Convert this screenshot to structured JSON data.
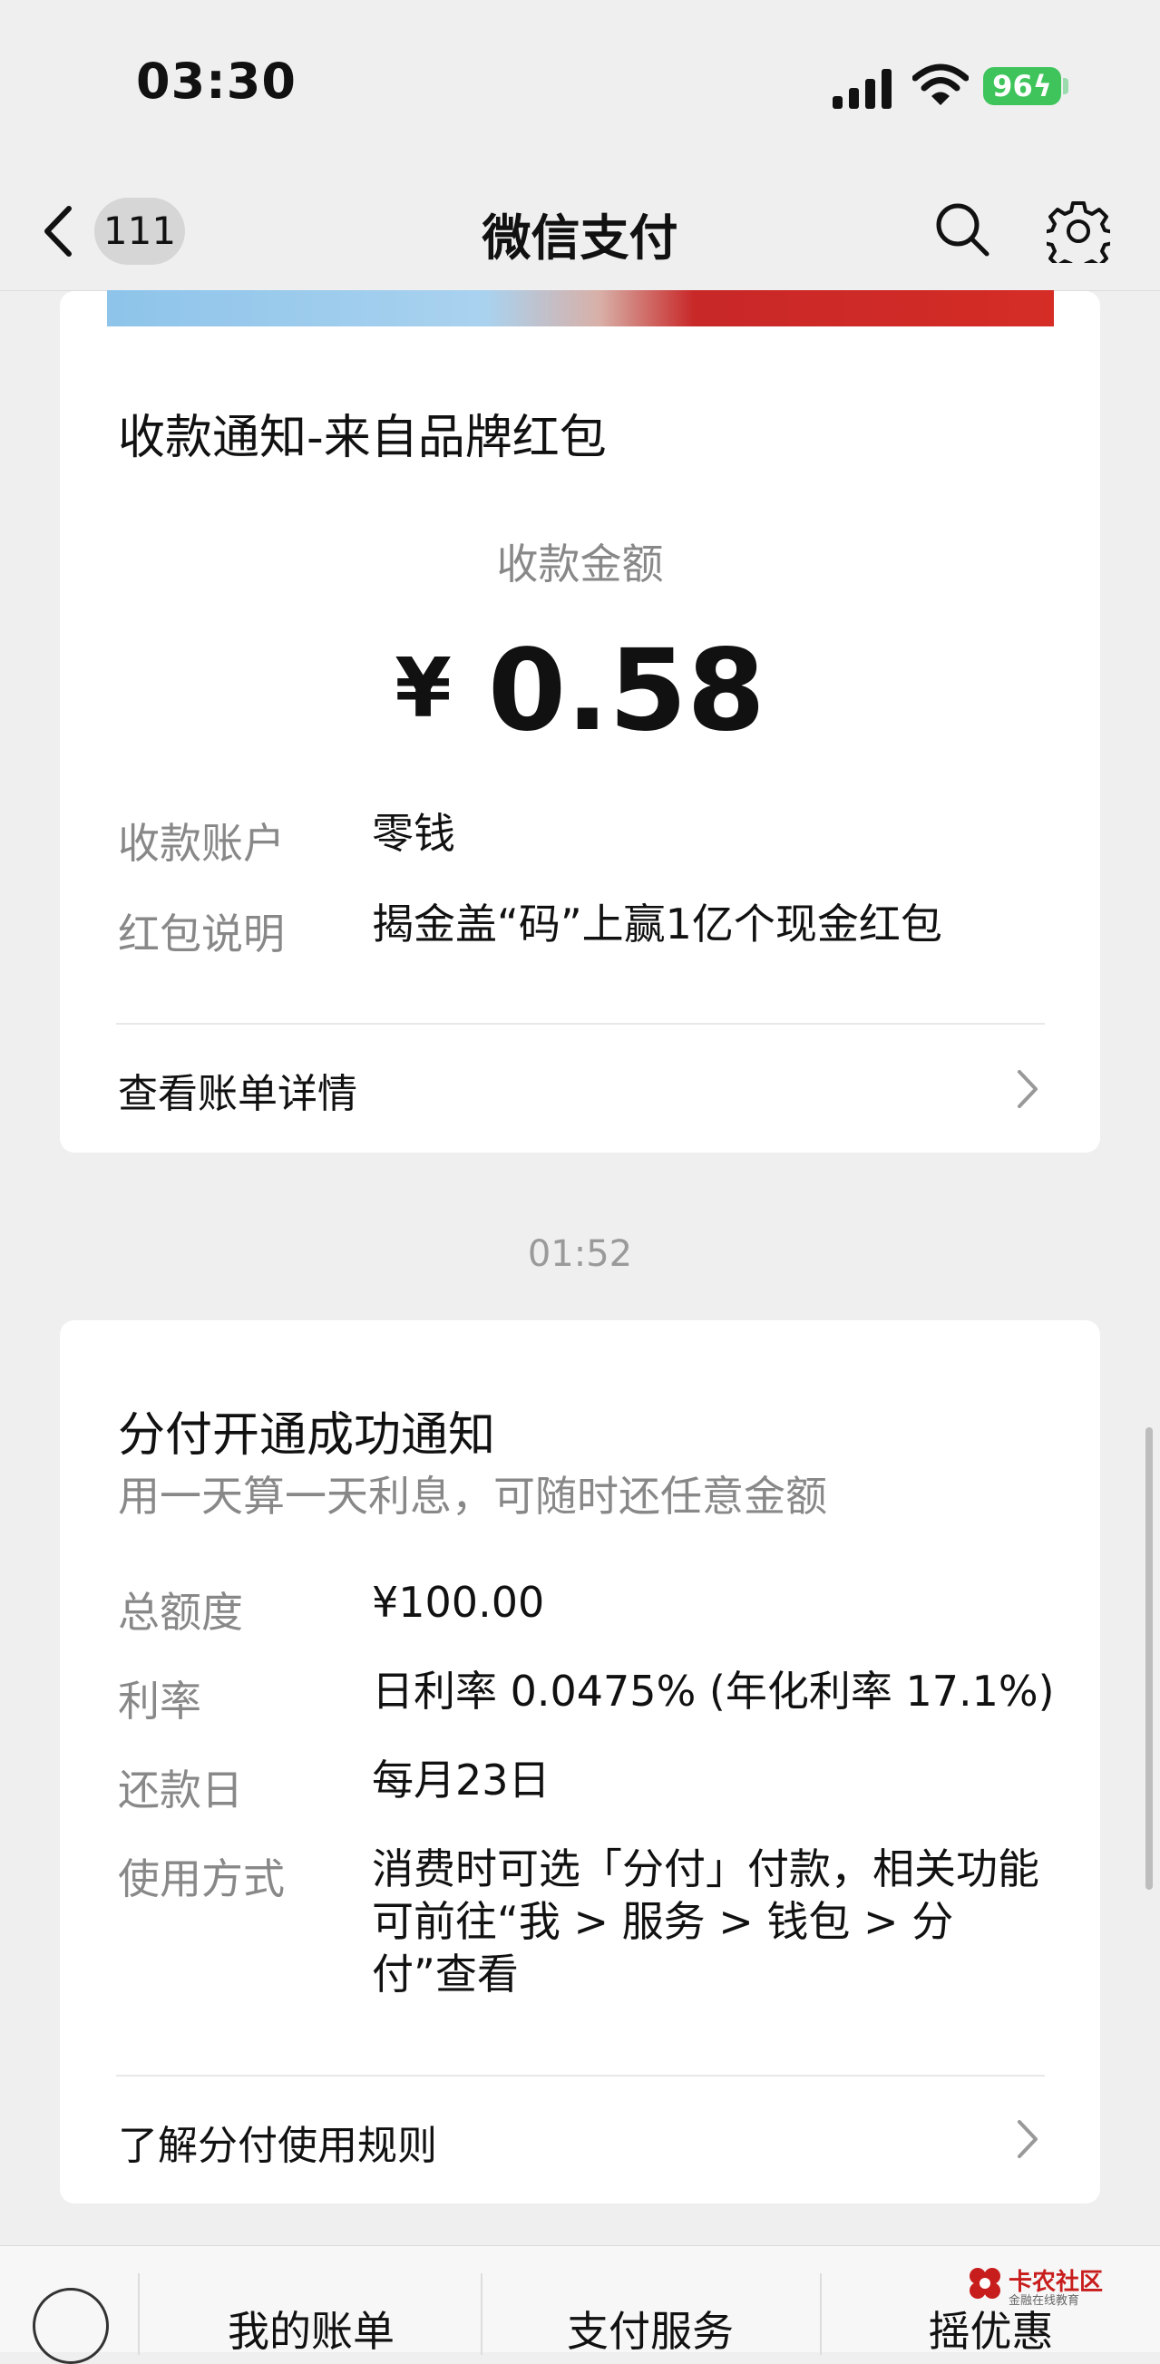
{
  "status_bar": {
    "time": "03:30",
    "battery": "96"
  },
  "nav": {
    "back_count": "111",
    "title": "微信支付"
  },
  "card1": {
    "title": "收款通知-来自品牌红包",
    "amount_label": "收款金额",
    "currency": "¥",
    "amount": "0.58",
    "rows": [
      {
        "label": "收款账户",
        "value": "零钱"
      },
      {
        "label": "红包说明",
        "value": "揭金盖“码”上赢1亿个现金红包"
      }
    ],
    "link": "查看账单详情"
  },
  "separator_time": "01:52",
  "card2": {
    "title": "分付开通成功通知",
    "subtitle": "用一天算一天利息，可随时还任意金额",
    "rows": [
      {
        "label": "总额度",
        "value": "¥100.00"
      },
      {
        "label": "利率",
        "value": "日利率 0.0475% (年化利率 17.1%)"
      },
      {
        "label": "还款日",
        "value": "每月23日"
      },
      {
        "label": "使用方式",
        "value": "消费时可选「分付」付款，相关功能可前往“我 > 服务 > 钱包 > 分付”查看"
      }
    ],
    "link": "了解分付使用规则"
  },
  "tabbar": {
    "tabs": [
      "我的账单",
      "支付服务",
      "摇优惠"
    ]
  },
  "watermark": {
    "name": "卡农社区",
    "sub": "金融在线教育"
  },
  "icons": {
    "back": "chevron-left-icon",
    "search": "search-icon",
    "settings": "gear-icon",
    "chevron": "chevron-right-icon",
    "keyboard": "keyboard-icon"
  },
  "colors": {
    "battery": "#3ec45b",
    "brand_red": "#c81d1d"
  }
}
